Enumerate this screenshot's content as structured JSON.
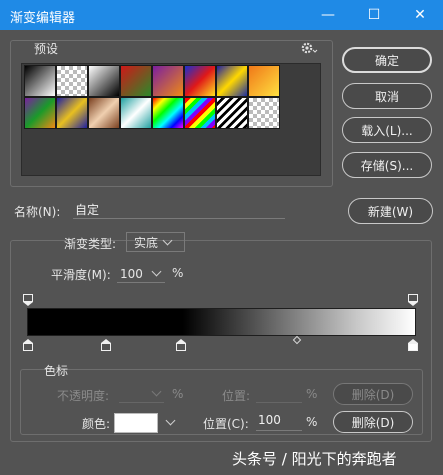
{
  "window": {
    "title": "渐变编辑器",
    "minimize_glyph": "—",
    "maximize_glyph": "☐",
    "close_glyph": "✕"
  },
  "presets": {
    "label": "预设",
    "gear_icon": "gear-icon",
    "swatches_row1": [
      {
        "bg": "linear-gradient(135deg,#000 0%,#fff 100%)"
      },
      {
        "bg": "repeating-conic-gradient(#bbb 0% 25%, #fff 0% 50%) 0 0/8px 8px"
      },
      {
        "bg": "linear-gradient(135deg,#fff 0%,#000 100%)"
      },
      {
        "bg": "linear-gradient(135deg,#d01818 0%,#2a8a2a 100%)"
      },
      {
        "bg": "linear-gradient(135deg,#7a1fa0 0%,#f08a14 100%)"
      },
      {
        "bg": "linear-gradient(135deg,#1a2fd0 0%,#e01818 50%,#ffe020 100%)"
      },
      {
        "bg": "linear-gradient(135deg,#2020a0 0%,#ffd800 50%,#1e2fa0 100%)"
      },
      {
        "bg": "linear-gradient(135deg,#f07818 0%,#ffe040 100%)"
      }
    ],
    "swatches_row2": [
      {
        "bg": "linear-gradient(135deg,#7a1fa0 0%,#1a9a2a 50%,#f08a14 100%)"
      },
      {
        "bg": "linear-gradient(135deg,#2020a0 0%,#e8c020 50%,#2020a0 100%)"
      },
      {
        "bg": "linear-gradient(135deg,#7a4020 0%,#f0d0b0 50%,#7a4020 100%)"
      },
      {
        "bg": "linear-gradient(135deg,#20a0a0 0%,#ffffff 50%,#20a0a0 100%)"
      },
      {
        "bg": "linear-gradient(135deg,#ff0000,#ffff00,#00ff00,#00ffff,#0000ff,#ff00ff)"
      },
      {
        "bg": "repeating-linear-gradient(135deg,#ff0000 0 4px,#ffff00 4px 8px,#00ff00 8px 12px,#00c0ff 12px 16px,#8000ff 16px 20px)"
      },
      {
        "bg": "repeating-linear-gradient(135deg,#fff 0 3px,#000 3px 6px)"
      },
      {
        "bg": "repeating-conic-gradient(#bbb 0% 25%, #fff 0% 50%) 0 0/8px 8px"
      }
    ]
  },
  "buttons": {
    "ok": "确定",
    "cancel": "取消",
    "load": "载入(L)...",
    "save": "存储(S)...",
    "new": "新建(W)"
  },
  "name": {
    "label": "名称(N):",
    "value": "自定"
  },
  "gradient_type": {
    "label": "渐变类型:",
    "value": "实底"
  },
  "smoothness": {
    "label": "平滑度(M):",
    "value": "100",
    "unit": "%"
  },
  "color_stops": {
    "section_label": "色标",
    "opacity_label": "不透明度:",
    "opacity_unit": "%",
    "position_label_disabled": "位置:",
    "position_unit_disabled": "%",
    "delete_disabled": "删除(D)",
    "color_label": "颜色:",
    "color_value": "#ffffff",
    "position_label": "位置(C):",
    "position_value": "100",
    "position_unit": "%",
    "delete": "删除(D)"
  },
  "watermark": "头条号 / 阳光下的奔跑者"
}
